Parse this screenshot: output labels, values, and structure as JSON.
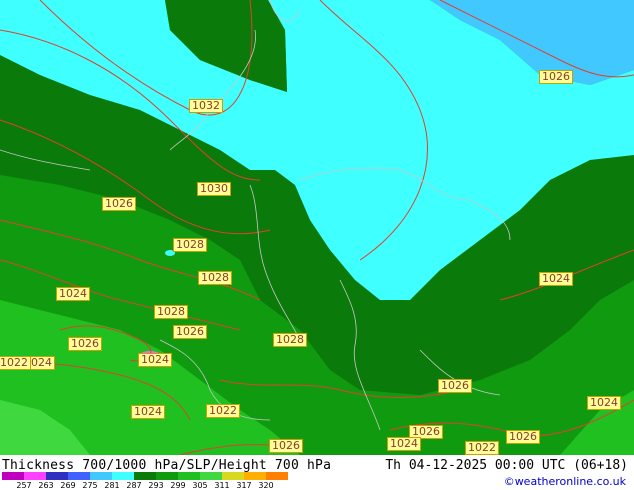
{
  "map": {
    "colors": {
      "dark_green": "#0a7a0a",
      "mid_green": "#0f9a0f",
      "light_green": "#1fc01f",
      "bright_green": "#3fd83f",
      "cyan": "#40ffff",
      "sky": "#40c8ff",
      "isobar": "#e04030",
      "border": "#c8c8c8"
    },
    "pressure_labels": [
      "1032",
      "1026",
      "1030",
      "1026",
      "1028",
      "1028",
      "1024",
      "1028",
      "1026",
      "1026",
      "1028",
      "1024",
      "1024",
      "1022",
      "1024",
      "1022",
      "1024",
      "1026",
      "1024",
      "1026",
      "1024",
      "1026",
      "1022",
      "1026",
      "1024"
    ]
  },
  "footer": {
    "title": "Thickness 700/1000 hPa/SLP/Height 700 hPa",
    "datetime": "Th 04-12-2025 00:00 UTC (06+18)",
    "credit": "©weatheronline.co.uk",
    "scale_values": [
      "257",
      "263",
      "269",
      "275",
      "281",
      "287",
      "293",
      "299",
      "305",
      "311",
      "317",
      "320"
    ],
    "scale_colors": [
      "#c000c0",
      "#ff40ff",
      "#3030c0",
      "#4060ff",
      "#40c8ff",
      "#40ffff",
      "#0a7a0a",
      "#0f9a0f",
      "#1fc01f",
      "#3fd83f",
      "#d8d820",
      "#ffb000",
      "#ff8000"
    ]
  }
}
